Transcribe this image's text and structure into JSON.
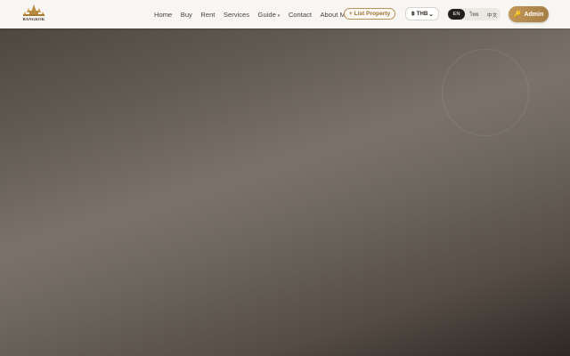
{
  "logo": {
    "text": "BANGKOK"
  },
  "nav": {
    "items": [
      {
        "label": "Home"
      },
      {
        "label": "Buy"
      },
      {
        "label": "Rent"
      },
      {
        "label": "Services"
      },
      {
        "label": "Guide",
        "has_dropdown": true
      },
      {
        "label": "Contact"
      },
      {
        "label": "About Me"
      }
    ]
  },
  "list_property": {
    "label": "+ List Property"
  },
  "currency": {
    "selected": "฿ THB"
  },
  "language": {
    "options": [
      "EN",
      "ไทย",
      "中文"
    ],
    "active": "EN"
  },
  "admin": {
    "icon": "key-icon",
    "label": "Admin"
  },
  "colors": {
    "accent": "#b08a4f",
    "header_bg": "#f8f6f3",
    "lang_active_bg": "#231f1c"
  }
}
